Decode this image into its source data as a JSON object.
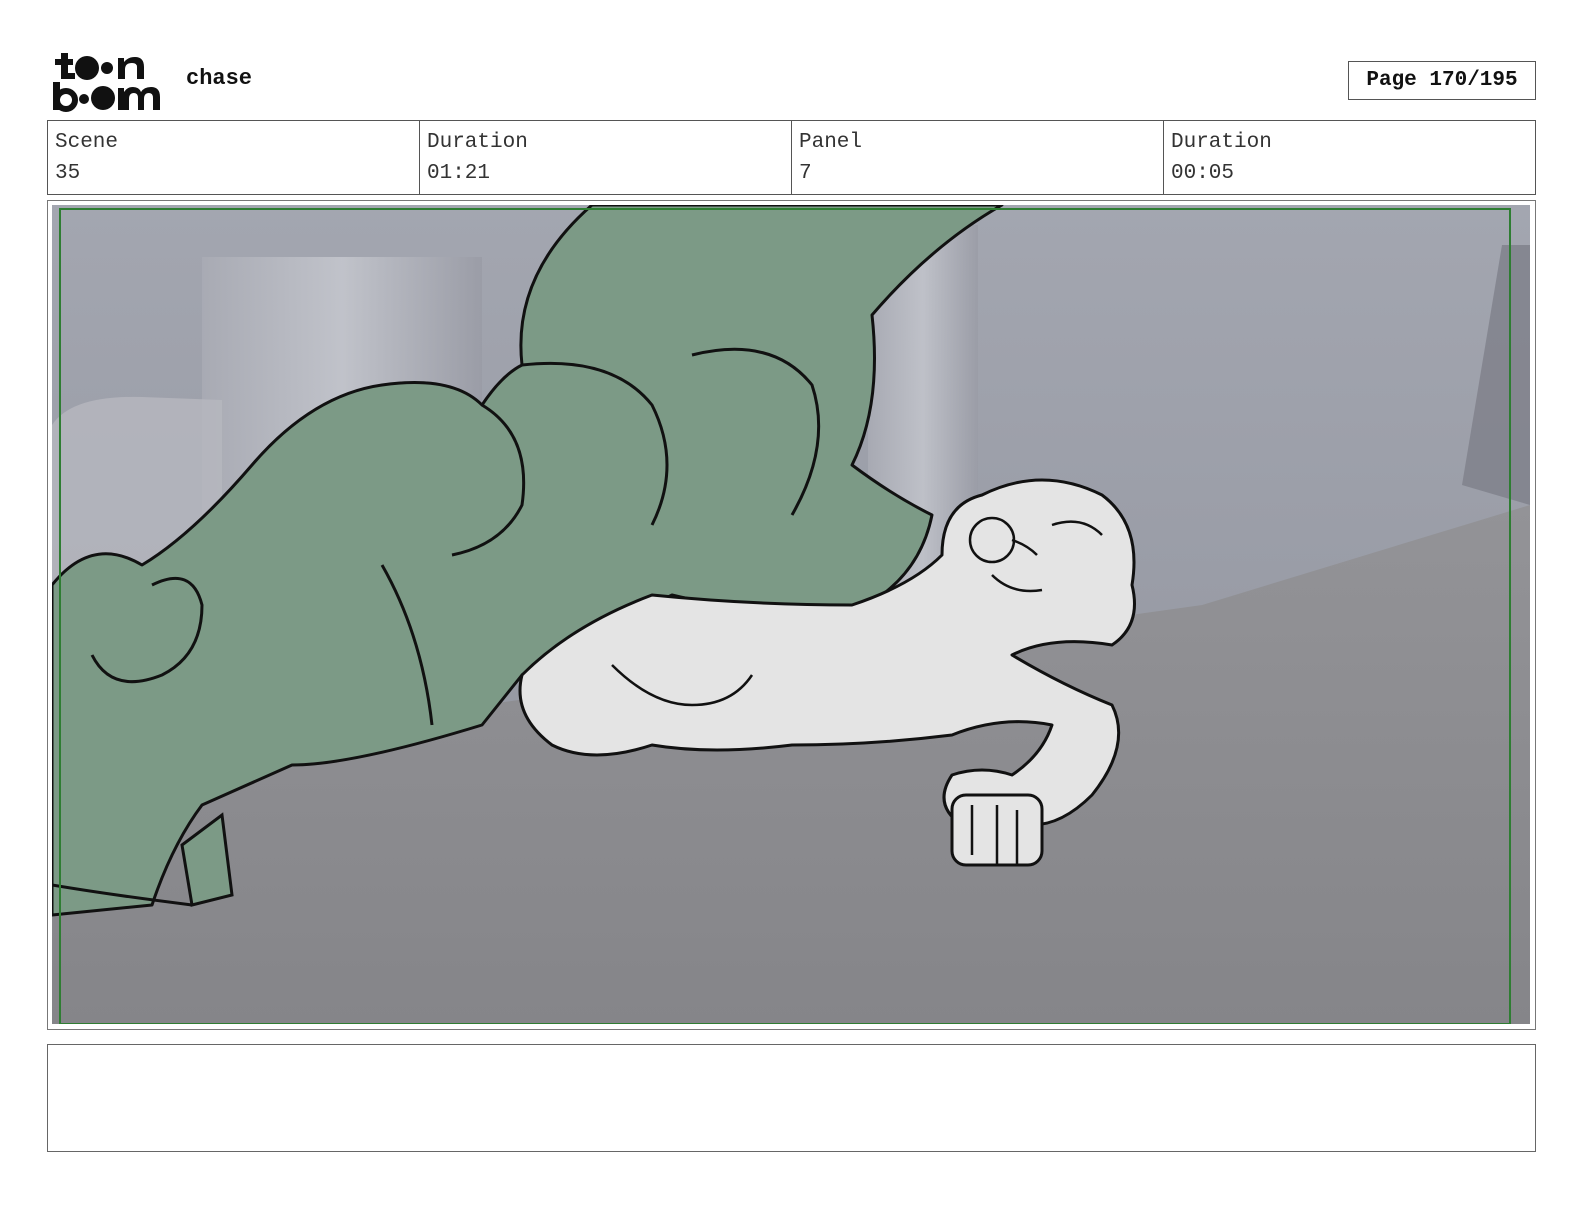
{
  "header": {
    "logo_text": "toon boom",
    "project_title": "chase",
    "page_label": "Page 170/195"
  },
  "info": {
    "scene_label": "Scene",
    "scene_value": "35",
    "scene_duration_label": "Duration",
    "scene_duration_value": "01:21",
    "panel_label": "Panel",
    "panel_value": "7",
    "panel_duration_label": "Duration",
    "panel_duration_value": "00:05"
  },
  "notes": {
    "text": ""
  },
  "colors": {
    "character_green": "#7c9a86",
    "floor_gray": "#8b8b8e",
    "wall_gray": "#9ea1ab",
    "safe_frame_green": "#2e7d32"
  }
}
